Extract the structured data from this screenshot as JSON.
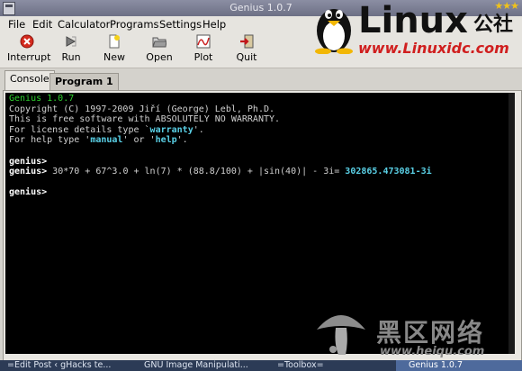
{
  "window": {
    "title": "Genius 1.0.7"
  },
  "menu": [
    "File",
    "Edit",
    "Calculator",
    "Programs",
    "Settings",
    "Help"
  ],
  "toolbar": [
    {
      "label": "Interrupt",
      "icon": "interrupt-icon"
    },
    {
      "label": "Run",
      "icon": "run-icon"
    },
    {
      "label": "New",
      "icon": "new-icon"
    },
    {
      "label": "Open",
      "icon": "open-icon"
    },
    {
      "label": "Plot",
      "icon": "plot-icon"
    },
    {
      "label": "Quit",
      "icon": "quit-icon"
    }
  ],
  "tabs": [
    {
      "label": "Console",
      "active": true
    },
    {
      "label": "Program 1",
      "active": false
    }
  ],
  "console": {
    "version_line": "Genius 1.0.7",
    "copyright": "Copyright (C) 1997-2009 Jiří (George) Lebl, Ph.D.",
    "free_line": "This is free software with ABSOLUTELY NO WARRANTY.",
    "license_pre": "For license details type `",
    "license_kw": "warranty",
    "license_post": "'.",
    "help_pre": "For help type '",
    "help_kw1": "manual",
    "help_mid": "' or '",
    "help_kw2": "help",
    "help_post": "'.",
    "prompt": "genius>",
    "input_expr": " 30*70 + 67^3.0 + ln(7) * (88.8/100) + |sin(40)| - 3i= ",
    "result": "302865.473081-3i"
  },
  "branding": {
    "logo_text": "Linux",
    "logo_cjk": "公社",
    "logo_url": "www.Linuxidc.com",
    "watermark_cjk": "黑区网络",
    "watermark_url": "www.heiqu.com"
  },
  "taskbar": [
    {
      "label": "=Edit Post ‹ gHacks te..."
    },
    {
      "label": "GNU Image Manipulati..."
    },
    {
      "label": "=Toolbox="
    },
    {
      "label": "Genius 1.0.7",
      "current": true
    }
  ],
  "colors": {
    "console_bg": "#000000",
    "keyword": "#5ad0e6",
    "version": "#2ed12e",
    "titlebar": "#7a7d92"
  }
}
